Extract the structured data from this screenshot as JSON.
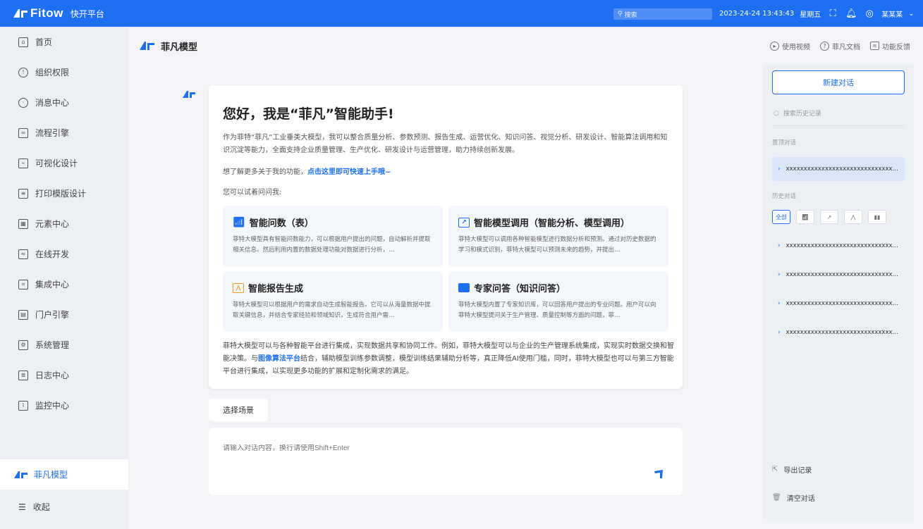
{
  "topbar": {
    "brand": "Fitow",
    "subtitle": "快开平台",
    "search_placeholder": "搜索",
    "datetime": "2023-24-24  13:43:43",
    "weekday": "星期五",
    "username": "某某某"
  },
  "sidebar": {
    "items": [
      {
        "label": "首页",
        "icon": "home-icon"
      },
      {
        "label": "组织权限",
        "icon": "shield-icon"
      },
      {
        "label": "消息中心",
        "icon": "bell-icon"
      },
      {
        "label": "流程引擎",
        "icon": "flow-icon"
      },
      {
        "label": "可视化设计",
        "icon": "chart-icon"
      },
      {
        "label": "打印模版设计",
        "icon": "printer-icon"
      },
      {
        "label": "元素中心",
        "icon": "grid-icon"
      },
      {
        "label": "在线开发",
        "icon": "code-icon"
      },
      {
        "label": "集成中心",
        "icon": "integration-icon"
      },
      {
        "label": "门户引擎",
        "icon": "portal-icon"
      },
      {
        "label": "系统管理",
        "icon": "settings-icon"
      },
      {
        "label": "日志中心",
        "icon": "log-icon"
      },
      {
        "label": "监控中心",
        "icon": "monitor-icon"
      }
    ],
    "model": "菲凡模型",
    "collapse": "收起"
  },
  "header": {
    "title": "菲凡模型",
    "links": [
      "使用视频",
      "菲凡文档",
      "功能反馈"
    ]
  },
  "welcome": {
    "hello": "您好，我是“菲凡”智能助手!",
    "intro": "作为菲特“菲凡”工业垂类大模型，我可以整合质量分析、参数预测、报告生成、运营优化、知识问答、视觉分析、研发设计、智能算法调用和知识沉淀等能力，全面支持企业质量管理、生产优化、研发设计与运营管理，助力持续创新发展。",
    "quick_prefix": "想了解更多关于我的功能，",
    "quick_link": "点击这里即可快速上手哦~",
    "try": "您可以试着问问我:",
    "features": [
      {
        "title": "智能问数（表）",
        "desc": "菲特大模型具有智能问数能力，可以根据用户提出的问题，自动解析并提取相关信息。然后利用内置的数据处理功能对数据进行分析，…"
      },
      {
        "title": "智能模型调用（智能分析、模型调用）",
        "desc": "菲特大模型可以调用各种智能模型进行数据分析和预测。通过对历史数据的学习和模式识别，菲特大模型可以预测未来的趋势，并提出…"
      },
      {
        "title": "智能报告生成",
        "desc": "菲特大模型可以根据用户的需求自动生成智能报告。它可以从海量数据中提取关键信息，并结合专家经验和领域知识，生成符合用户需…"
      },
      {
        "title": "专家问答（知识问答）",
        "desc": "菲特大模型内置了专家知识库，可以回答用户提出的专业问题。用户可以向菲特大模型提问关于生产管理、质量控制等方面的问题，菲…"
      }
    ],
    "closing_a": "菲特大模型可以与各种智能平台进行集成，实现数据共享和协同工作。例如，菲特大模型可以与企业的生产管理系统集成，实现实时数据交换和智能决策。与",
    "closing_link": "图像算法平台",
    "closing_b": "结合，辅助模型训练参数调整，模型训练结果辅助分析等，真正降低AI使用门槛，同时，菲特大模型也可以与第三方智能平台进行集成，以实现更多功能的扩展和定制化需求的满足。"
  },
  "input": {
    "scene_button": "选择场景",
    "placeholder": "请输入对话内容，换行请使用Shift+Enter"
  },
  "rightpanel": {
    "new_chat": "新建对话",
    "search_placeholder": "搜索历史记录",
    "pinned_label": "置顶对话",
    "pinned": "xxxxxxxxxxxxxxxxxxxxxxxxxxxxxx…",
    "history_label": "历史对话",
    "filter_all": "全部",
    "history": [
      "xxxxxxxxxxxxxxxxxxxxxxxxxxxxxx…",
      "xxxxxxxxxxxxxxxxxxxxxxxxxxxxxx…",
      "xxxxxxxxxxxxxxxxxxxxxxxxxxxxxx…",
      "xxxxxxxxxxxxxxxxxxxxxxxxxxxxxx…"
    ],
    "export": "导出记录",
    "clear": "清空对话"
  },
  "colors": {
    "accent": "#1e6ff1",
    "sidebar": "#eceff4",
    "page": "#f2f4f8"
  }
}
